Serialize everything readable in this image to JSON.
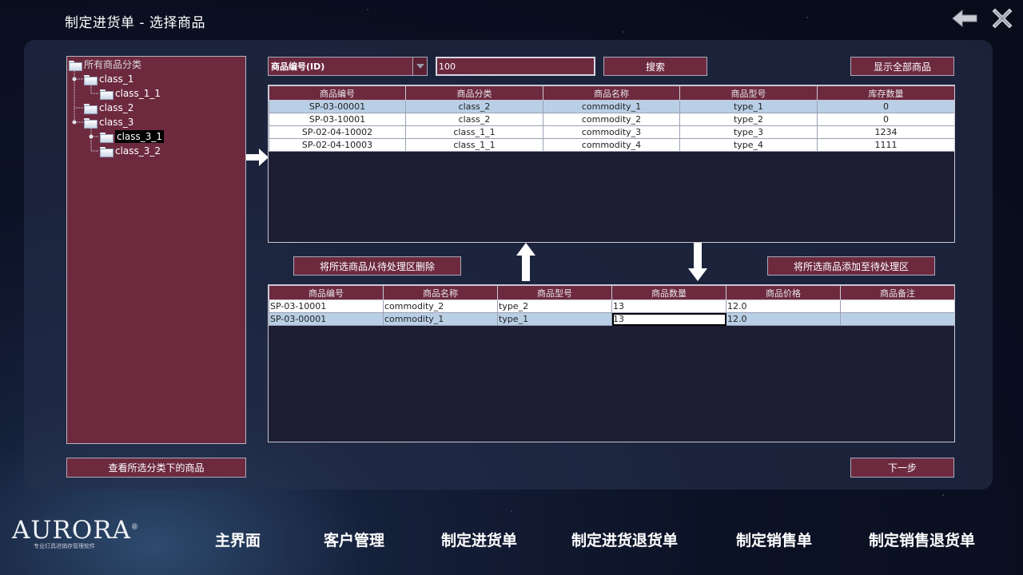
{
  "window": {
    "title": "制定进货单 - 选择商品",
    "back_icon": "back-arrow-icon",
    "close_icon": "close-icon"
  },
  "tree": {
    "root": "所有商品分类",
    "nodes": [
      {
        "label": "class_1",
        "level": 1
      },
      {
        "label": "class_1_1",
        "level": 2
      },
      {
        "label": "class_2",
        "level": 1
      },
      {
        "label": "class_3",
        "level": 1
      },
      {
        "label": "class_3_1",
        "level": 2,
        "selected": true
      },
      {
        "label": "class_3_2",
        "level": 2
      }
    ],
    "view_button": "查看所选分类下的商品"
  },
  "search": {
    "field_select": "商品编号(ID)",
    "query": "100",
    "search_button": "搜索",
    "show_all_button": "显示全部商品"
  },
  "goods_table": {
    "columns": [
      "商品编号",
      "商品分类",
      "商品名称",
      "商品型号",
      "库存数量"
    ],
    "rows": [
      [
        "SP-03-00001",
        "class_2",
        "commodity_1",
        "type_1",
        "0"
      ],
      [
        "SP-03-10001",
        "class_2",
        "commodity_2",
        "type_2",
        "0"
      ],
      [
        "SP-02-04-10002",
        "class_1_1",
        "commodity_3",
        "type_3",
        "1234"
      ],
      [
        "SP-02-04-10003",
        "class_1_1",
        "commodity_4",
        "type_4",
        "1111"
      ]
    ],
    "selected_row": 0
  },
  "actions": {
    "remove_button": "将所选商品从待处理区删除",
    "add_button": "将所选商品添加至待处理区"
  },
  "pending_table": {
    "columns": [
      "商品编号",
      "商品名称",
      "商品型号",
      "商品数量",
      "商品价格",
      "商品备注"
    ],
    "rows": [
      [
        "SP-03-10001",
        "commodity_2",
        "type_2",
        "13",
        "12.0",
        ""
      ],
      [
        "SP-03-00001",
        "commodity_1",
        "type_1",
        "13",
        "12.0",
        ""
      ]
    ],
    "selected_row": 1
  },
  "next_button": "下一步",
  "nav": [
    "主界面",
    "客户管理",
    "制定进货单",
    "制定进货退货单",
    "制定销售单",
    "制定销售退货单"
  ],
  "brand": {
    "logo": "AURORA",
    "registered": "®",
    "tagline": "专业灯具进销存管理软件"
  },
  "colors": {
    "accent": "#6d2a3f",
    "selection": "#b9cfe6",
    "border": "#c9c9d4"
  }
}
